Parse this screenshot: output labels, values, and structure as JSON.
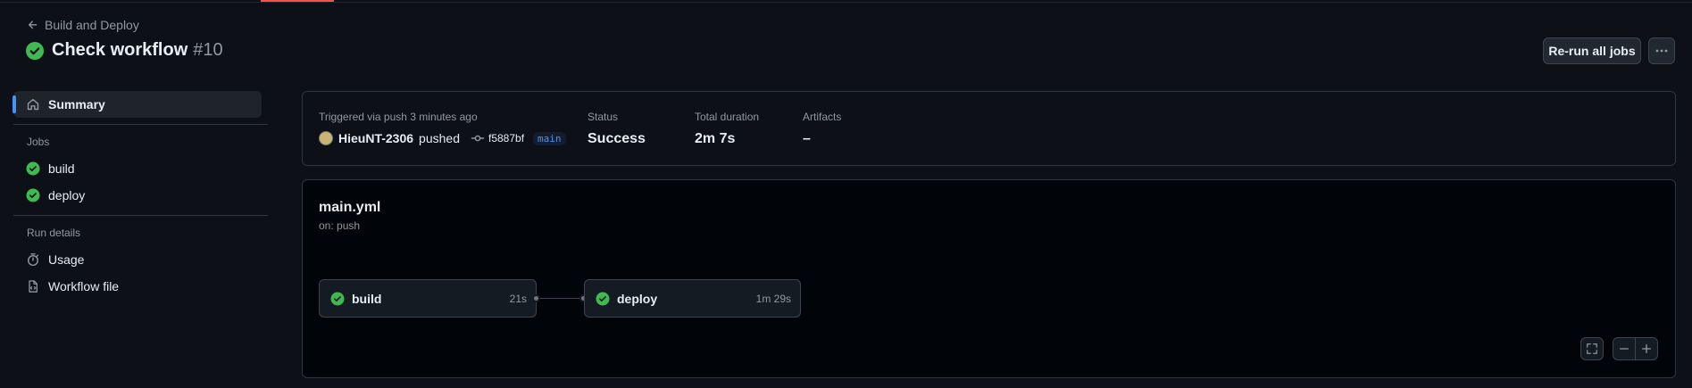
{
  "header": {
    "back_label": "Build and Deploy",
    "title": "Check workflow",
    "run_number": "#10",
    "rerun_label": "Re-run all jobs"
  },
  "sidebar": {
    "summary_label": "Summary",
    "jobs_heading": "Jobs",
    "jobs": [
      {
        "label": "build",
        "status": "success"
      },
      {
        "label": "deploy",
        "status": "success"
      }
    ],
    "run_details_heading": "Run details",
    "usage_label": "Usage",
    "workflow_file_label": "Workflow file"
  },
  "summary": {
    "trigger_label": "Triggered via push 3 minutes ago",
    "actor": "HieuNT-2306",
    "action": "pushed",
    "commit": "f5887bf",
    "branch": "main",
    "status_label": "Status",
    "status_value": "Success",
    "duration_label": "Total duration",
    "duration_value": "2m 7s",
    "artifacts_label": "Artifacts",
    "artifacts_value": "–"
  },
  "graph": {
    "file": "main.yml",
    "trigger": "on: push",
    "jobs": [
      {
        "name": "build",
        "duration": "21s",
        "status": "success"
      },
      {
        "name": "deploy",
        "duration": "1m 29s",
        "status": "success"
      }
    ]
  },
  "colors": {
    "success": "#3fb950",
    "accent": "#4493f8",
    "background": "#0d1117"
  },
  "icons": [
    "arrow-left-icon",
    "check-circle-fill-icon",
    "kebab-horizontal-icon",
    "home-icon",
    "stopwatch-icon",
    "file-code-icon",
    "git-commit-icon",
    "fullscreen-icon",
    "zoom-out-icon",
    "zoom-in-icon"
  ]
}
